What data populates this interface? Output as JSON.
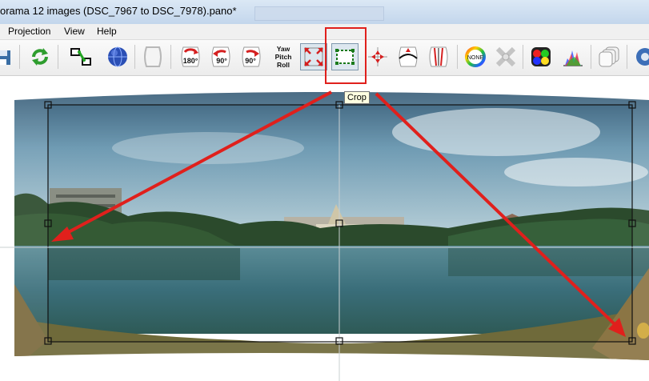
{
  "window": {
    "title": "orama 12 images (DSC_7967 to DSC_7978).pano*"
  },
  "menu": {
    "projection": "Projection",
    "view": "View",
    "help": "Help"
  },
  "toolbar": {
    "icons": [
      "save-icon",
      "refresh-icon",
      "control-points-icon",
      "sphere-icon",
      "blank-frame-icon",
      "rotate-180-icon",
      "rotate-ccw-90-icon",
      "rotate-cw-90-icon",
      "yaw-pitch-roll-icon",
      "fit-icon",
      "crop-icon",
      "center-icon",
      "straighten-icon",
      "stretch-icon",
      "no-blend-icon",
      "tools-icon",
      "color-icon",
      "histogram-icon",
      "layers-icon",
      "settings-icon"
    ],
    "rotate180_label": "180°",
    "rotate90_label": "90°",
    "ypr_yaw": "Yaw",
    "ypr_pitch": "Pitch",
    "ypr_roll": "Roll",
    "none_label": "NONE"
  },
  "tooltip": {
    "text": "Crop"
  },
  "colors": {
    "annotation": "#e0201c",
    "crop_frame": "#1a1a1a",
    "menu_bg": "#f0f0f0"
  }
}
